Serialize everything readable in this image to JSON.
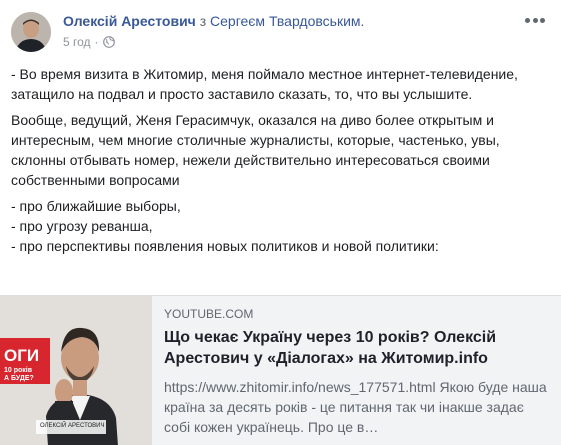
{
  "post": {
    "author": "Олексій Арестович",
    "with_word": " з ",
    "tagged_person": "Сергеєм Твардовським.",
    "timestamp": "5 год",
    "separator": "·",
    "privacy_icon": "globe-icon",
    "more_icon": "more-options-icon",
    "paragraphs": [
      "- Во время визита в Житомир, меня поймало местное интернет-телевидение, затащило на подвал и просто заставило сказать, то, что вы услышите.",
      "Вообще, ведущий, Женя Герасимчук, оказался на диво более открытым и интересным, чем многие столичные журналисты, которые, частенько, увы, склонны отбывать номер, нежели действительно интересоваться своими собственными вопросами"
    ],
    "list": [
      "- про ближайшие выборы,",
      "- про угрозу реванша,",
      "- про перспективы появления новых политиков и новой политики:"
    ]
  },
  "link_card": {
    "source": "YOUTUBE.COM",
    "title": "Що чекає Україну через 10 років? Олексій Арестович у «Діалогах» на Житомир.info",
    "description": "https://www.zhitomir.info/news_177571.html Якою буде наша країна за десять років - це питання так чи інакше задає собі кожен українець. Про це в…",
    "thumbnail": {
      "badge_text": "ОГИ",
      "badge_sub1": "10 років",
      "badge_sub2": "А БУДЕ?",
      "caption_name": "ОЛЕКСІЙ АРЕСТОВИЧ"
    }
  },
  "colors": {
    "link_blue": "#385898",
    "meta_gray": "#90949c",
    "card_bg": "#f2f3f5",
    "badge_red": "#d7262e"
  }
}
